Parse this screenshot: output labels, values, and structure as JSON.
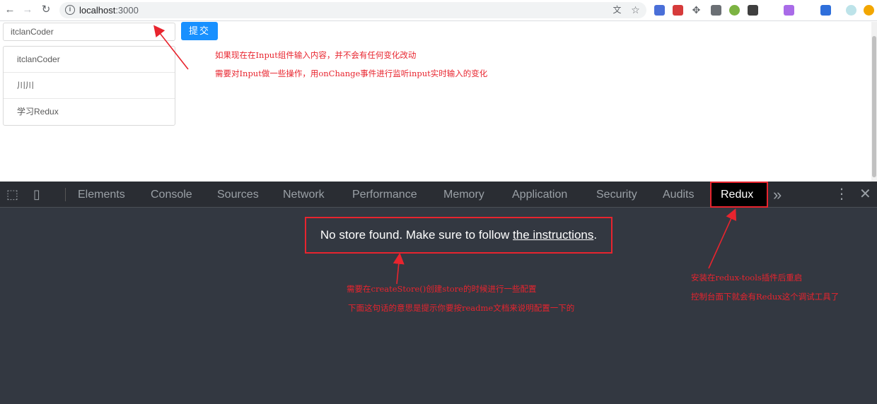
{
  "browser": {
    "url_host": "localhost",
    "url_port": ":3000",
    "extensions": [
      {
        "icon": "translate-icon",
        "color": "#5f6368",
        "glyph": "文"
      },
      {
        "icon": "star-icon",
        "color": "#5f6368",
        "glyph": "☆"
      }
    ]
  },
  "app": {
    "input_value": "itclanCoder",
    "submit_label": "提交",
    "list_items": [
      "itclanCoder",
      "川川",
      "学习Redux"
    ],
    "note_line1": "如果现在在Input组件输入内容，并不会有任何变化改动",
    "note_line2": "需要对Input做一些操作，用onChange事件进行监听input实时输入的变化"
  },
  "devtools": {
    "tabs": [
      "Elements",
      "Console",
      "Sources",
      "Network",
      "Performance",
      "Memory",
      "Application",
      "Security",
      "Audits",
      "Redux"
    ],
    "active_tab": "Redux",
    "more_tabs_glyph": "»",
    "no_store_text": "No store found. Make sure to follow ",
    "no_store_link": "the instructions",
    "no_store_end": ".",
    "annot_center_line1": "需要在createStore()创建store的时候进行一些配置",
    "annot_center_line2": "下面这句话的意思是提示你要按readme文档来说明配置一下的",
    "annot_right_line1": "安装在redux-tools插件后重启",
    "annot_right_line2": "控制台面下就会有Redux这个调试工具了"
  },
  "colors": {
    "accent": "#1890ff",
    "annotation": "#e8242e",
    "devtools_bg": "#333841"
  }
}
